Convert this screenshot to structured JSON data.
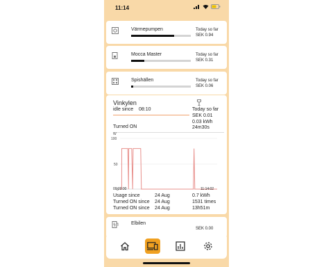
{
  "status": {
    "time": "11:14"
  },
  "devices": [
    {
      "name": "Värmepumpen",
      "icon": "heat-pump-icon",
      "today": "Today so far",
      "amount": "SEK 0.94",
      "level": 0.72
    },
    {
      "name": "Mocca Master",
      "icon": "coffee-machine-icon",
      "today": "Today so far",
      "amount": "SEK 0.31",
      "level": 0.22
    },
    {
      "name": "Spishällen",
      "icon": "stove-icon",
      "today": "Today so far",
      "amount": "SEK 0.06",
      "level": 0.03
    }
  ],
  "detail": {
    "title": "Vinkylen",
    "icon": "wine-glass-icon",
    "state": "idle since",
    "since_time": "08:10",
    "today": "Today so far",
    "amount": "SEK 0.01",
    "energy": "0.03 kWh",
    "turned_on_label": "Turned ON",
    "turned_on_duration": "24m30s",
    "chart_data": {
      "type": "line",
      "ylabel": "W",
      "yticks": [
        "100",
        "50",
        "0"
      ],
      "ylim": [
        0,
        100
      ],
      "xlabel_start": "00:00:00",
      "xlabel_end": "11:14:02",
      "x": [
        0,
        0.017,
        0.018,
        0.08,
        0.088,
        0.09,
        0.12,
        0.13,
        0.135,
        0.213,
        0.22,
        0.222,
        0.36,
        0.52,
        0.7,
        0.755,
        0.762,
        0.77,
        1.0
      ],
      "values": [
        0,
        0,
        80,
        80,
        0,
        80,
        80,
        0,
        80,
        80,
        0,
        0,
        0,
        0,
        0,
        0,
        80,
        0,
        0
      ],
      "color": "#e8908c"
    },
    "usage_label": "Usage since",
    "usage_date": "24 Aug",
    "usage_value": "0.7 kWh",
    "count_label": "Turned ON since",
    "count_date": "24 Aug",
    "count_value": "1531 times",
    "dur_label": "Turned ON since",
    "dur_date": "24 Aug",
    "dur_value": "13h51m"
  },
  "partial_device": {
    "name": "Elbilen",
    "icon": "ev-charger-icon",
    "amount": "SEK 0.00"
  },
  "nav": [
    {
      "name": "home",
      "icon": "home-icon",
      "active": false
    },
    {
      "name": "devices",
      "icon": "devices-icon",
      "active": true
    },
    {
      "name": "stats",
      "icon": "stats-icon",
      "active": false
    },
    {
      "name": "settings",
      "icon": "gear-icon",
      "active": false
    }
  ]
}
